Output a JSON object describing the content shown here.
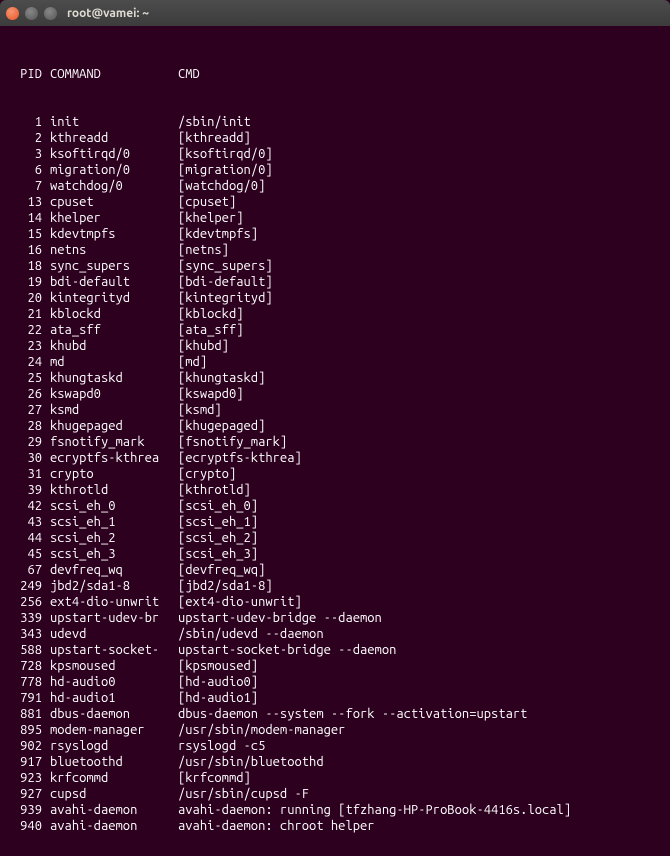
{
  "window": {
    "title": "root@vamei: ~"
  },
  "headers": {
    "pid": "PID",
    "command": "COMMAND",
    "cmd": "CMD"
  },
  "processes": [
    {
      "pid": "1",
      "command": "init",
      "cmd": "/sbin/init"
    },
    {
      "pid": "2",
      "command": "kthreadd",
      "cmd": "[kthreadd]"
    },
    {
      "pid": "3",
      "command": "ksoftirqd/0",
      "cmd": "[ksoftirqd/0]"
    },
    {
      "pid": "6",
      "command": "migration/0",
      "cmd": "[migration/0]"
    },
    {
      "pid": "7",
      "command": "watchdog/0",
      "cmd": "[watchdog/0]"
    },
    {
      "pid": "13",
      "command": "cpuset",
      "cmd": "[cpuset]"
    },
    {
      "pid": "14",
      "command": "khelper",
      "cmd": "[khelper]"
    },
    {
      "pid": "15",
      "command": "kdevtmpfs",
      "cmd": "[kdevtmpfs]"
    },
    {
      "pid": "16",
      "command": "netns",
      "cmd": "[netns]"
    },
    {
      "pid": "18",
      "command": "sync_supers",
      "cmd": "[sync_supers]"
    },
    {
      "pid": "19",
      "command": "bdi-default",
      "cmd": "[bdi-default]"
    },
    {
      "pid": "20",
      "command": "kintegrityd",
      "cmd": "[kintegrityd]"
    },
    {
      "pid": "21",
      "command": "kblockd",
      "cmd": "[kblockd]"
    },
    {
      "pid": "22",
      "command": "ata_sff",
      "cmd": "[ata_sff]"
    },
    {
      "pid": "23",
      "command": "khubd",
      "cmd": "[khubd]"
    },
    {
      "pid": "24",
      "command": "md",
      "cmd": "[md]"
    },
    {
      "pid": "25",
      "command": "khungtaskd",
      "cmd": "[khungtaskd]"
    },
    {
      "pid": "26",
      "command": "kswapd0",
      "cmd": "[kswapd0]"
    },
    {
      "pid": "27",
      "command": "ksmd",
      "cmd": "[ksmd]"
    },
    {
      "pid": "28",
      "command": "khugepaged",
      "cmd": "[khugepaged]"
    },
    {
      "pid": "29",
      "command": "fsnotify_mark",
      "cmd": "[fsnotify_mark]"
    },
    {
      "pid": "30",
      "command": "ecryptfs-kthrea",
      "cmd": "[ecryptfs-kthrea]"
    },
    {
      "pid": "31",
      "command": "crypto",
      "cmd": "[crypto]"
    },
    {
      "pid": "39",
      "command": "kthrotld",
      "cmd": "[kthrotld]"
    },
    {
      "pid": "42",
      "command": "scsi_eh_0",
      "cmd": "[scsi_eh_0]"
    },
    {
      "pid": "43",
      "command": "scsi_eh_1",
      "cmd": "[scsi_eh_1]"
    },
    {
      "pid": "44",
      "command": "scsi_eh_2",
      "cmd": "[scsi_eh_2]"
    },
    {
      "pid": "45",
      "command": "scsi_eh_3",
      "cmd": "[scsi_eh_3]"
    },
    {
      "pid": "67",
      "command": "devfreq_wq",
      "cmd": "[devfreq_wq]"
    },
    {
      "pid": "249",
      "command": "jbd2/sda1-8",
      "cmd": "[jbd2/sda1-8]"
    },
    {
      "pid": "256",
      "command": "ext4-dio-unwrit",
      "cmd": "[ext4-dio-unwrit]"
    },
    {
      "pid": "339",
      "command": "upstart-udev-br",
      "cmd": "upstart-udev-bridge --daemon"
    },
    {
      "pid": "343",
      "command": "udevd",
      "cmd": "/sbin/udevd --daemon"
    },
    {
      "pid": "588",
      "command": "upstart-socket-",
      "cmd": "upstart-socket-bridge --daemon"
    },
    {
      "pid": "728",
      "command": "kpsmoused",
      "cmd": "[kpsmoused]"
    },
    {
      "pid": "778",
      "command": "hd-audio0",
      "cmd": "[hd-audio0]"
    },
    {
      "pid": "791",
      "command": "hd-audio1",
      "cmd": "[hd-audio1]"
    },
    {
      "pid": "881",
      "command": "dbus-daemon",
      "cmd": "dbus-daemon --system --fork --activation=upstart"
    },
    {
      "pid": "895",
      "command": "modem-manager",
      "cmd": "/usr/sbin/modem-manager"
    },
    {
      "pid": "902",
      "command": "rsyslogd",
      "cmd": "rsyslogd -c5"
    },
    {
      "pid": "917",
      "command": "bluetoothd",
      "cmd": "/usr/sbin/bluetoothd"
    },
    {
      "pid": "923",
      "command": "krfcommd",
      "cmd": "[krfcommd]"
    },
    {
      "pid": "927",
      "command": "cupsd",
      "cmd": "/usr/sbin/cupsd -F"
    },
    {
      "pid": "939",
      "command": "avahi-daemon",
      "cmd": "avahi-daemon: running [tfzhang-HP-ProBook-4416s.local]"
    },
    {
      "pid": "940",
      "command": "avahi-daemon",
      "cmd": "avahi-daemon: chroot helper"
    }
  ]
}
